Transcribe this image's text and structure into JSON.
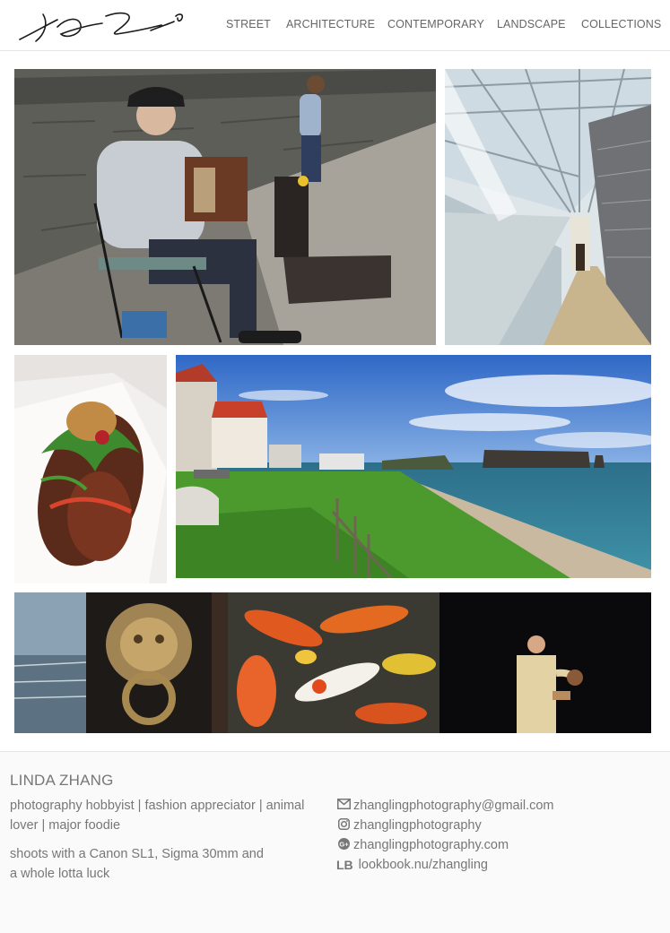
{
  "header": {
    "logo_alt": "signature logo",
    "nav": [
      {
        "label": "STREET"
      },
      {
        "label": "ARCHITECTURE"
      },
      {
        "label": "CONTEMPORARY"
      },
      {
        "label": "LANDSCAPE"
      },
      {
        "label": "COLLECTIONS"
      }
    ]
  },
  "gallery": {
    "photos": [
      {
        "subject": "accordion street musician"
      },
      {
        "subject": "glass skylight walkway"
      },
      {
        "subject": "grilled meat wrap"
      },
      {
        "subject": "coastal landscape with rock"
      },
      {
        "subject": "door knocker, koi fish and performer collage"
      }
    ]
  },
  "footer": {
    "name": "LINDA ZHANG",
    "bio_line1": "photography hobbyist | fashion appreciator | animal lover | major foodie",
    "bio_line2": "shoots with a Canon SL1, Sigma 30mm and a whole lotta luck",
    "contacts": {
      "email": "zhanglingphotography@gmail.com",
      "instagram": "zhanglingphotography",
      "website": "zhanglingphotography.com",
      "lookbook_badge": "LB",
      "lookbook": "lookbook.nu/zhangling"
    }
  }
}
